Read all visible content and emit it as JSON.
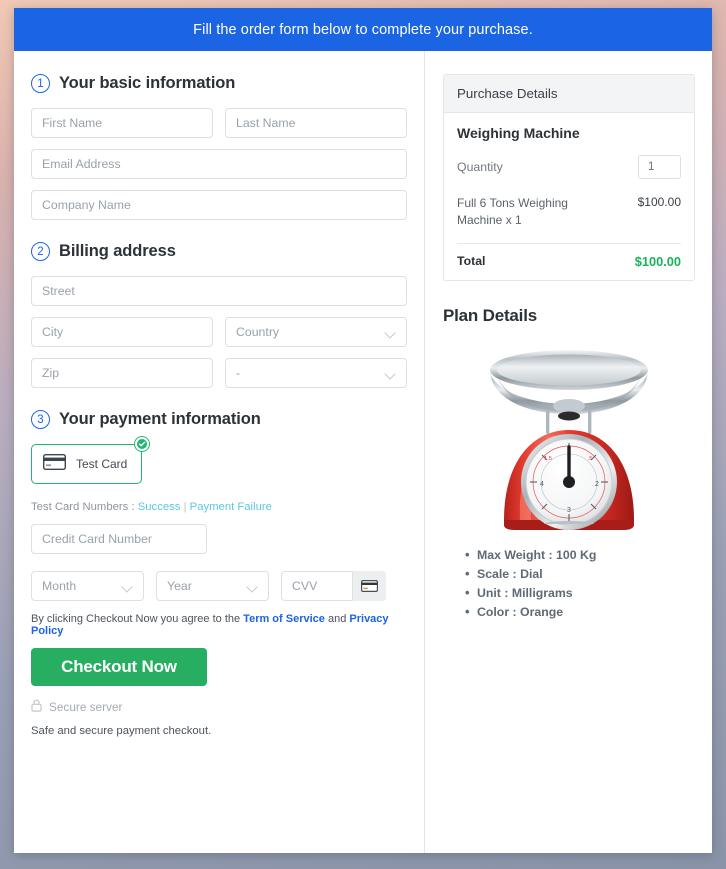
{
  "banner": {
    "text": "Fill the order form below to complete your purchase."
  },
  "sections": {
    "basic": {
      "number": "1",
      "title": "Your basic information",
      "fields": {
        "first_name": "First Name",
        "last_name": "Last Name",
        "email": "Email Address",
        "company": "Company Name"
      }
    },
    "billing": {
      "number": "2",
      "title": "Billing address",
      "fields": {
        "street": "Street",
        "city": "City",
        "country": "Country",
        "zip": "Zip",
        "state": "-"
      }
    },
    "payment": {
      "number": "3",
      "title": "Your payment information",
      "method": {
        "label": "Test Card",
        "card_icon": "credit-card-icon",
        "selected_icon": "check-circle-icon"
      },
      "test_numbers": {
        "prefix": "Test Card Numbers :",
        "success": "Success",
        "separator": "|",
        "failure": "Payment Failure"
      },
      "fields": {
        "card_number": "Credit Card Number",
        "month": "Month",
        "year": "Year",
        "cvv": "CVV"
      },
      "cvv_icon": "credit-card-icon"
    }
  },
  "footer": {
    "terms_prefix": "By clicking Checkout Now you agree to the",
    "terms_link": "Term of Service",
    "terms_and": "and",
    "privacy_link": "Privacy Policy",
    "checkout_label": "Checkout Now",
    "secure_icon": "lock-icon",
    "secure_label": "Secure server",
    "safe_note": "Safe and secure payment checkout."
  },
  "purchase": {
    "header": "Purchase Details",
    "product_name": "Weighing Machine",
    "quantity_label": "Quantity",
    "quantity_value": "1",
    "line_item": {
      "description": "Full 6 Tons Weighing Machine x 1",
      "amount": "$100.00"
    },
    "total_label": "Total",
    "total_amount": "$100.00"
  },
  "plan": {
    "title": "Plan Details",
    "image_name": "weighing-machine-photo",
    "specs": [
      "Max Weight : 100 Kg",
      "Scale : Dial",
      "Unit : Milligrams",
      "Color : Orange"
    ]
  },
  "colors": {
    "banner_blue": "#1b64e3",
    "accent_green": "#27ae60",
    "total_green": "#19b35a",
    "link_blue": "#1b64e3",
    "test_link": "#5cc8e0"
  }
}
